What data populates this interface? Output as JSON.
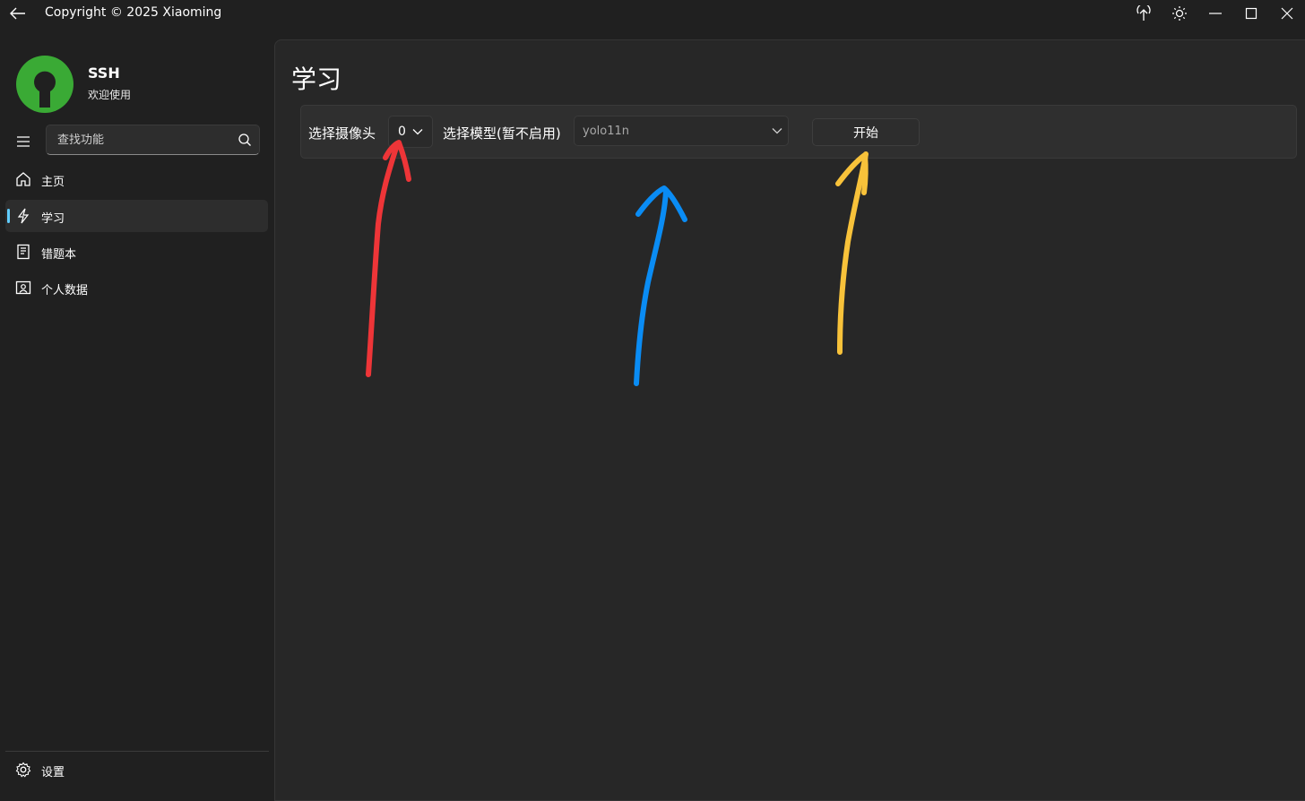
{
  "titlebar": {
    "title": "Copyright © 2025 Xiaoming",
    "back_icon": "back-arrow-icon",
    "actions": [
      "pin-up-icon",
      "theme-sun-icon",
      "minimize-icon",
      "maximize-icon",
      "close-icon"
    ]
  },
  "sidebar": {
    "user": {
      "name": "SSH",
      "subtitle": "欢迎使用"
    },
    "search": {
      "placeholder": "查找功能"
    },
    "items": [
      {
        "label": "主页",
        "icon": "home-icon",
        "active": false
      },
      {
        "label": "学习",
        "icon": "lightning-icon",
        "active": true
      },
      {
        "label": "错题本",
        "icon": "notebook-icon",
        "active": false
      },
      {
        "label": "个人数据",
        "icon": "contact-icon",
        "active": false
      }
    ],
    "settings": {
      "label": "设置",
      "icon": "gear-icon"
    }
  },
  "main": {
    "title": "学习",
    "toolbar": {
      "camera_label": "选择摄像头",
      "camera_value": "0",
      "model_label": "选择模型(暂不启用)",
      "model_value": "yolo11n",
      "start_label": "开始"
    }
  },
  "colors": {
    "accent": "#60cdff",
    "arrow_red": "#ee3538",
    "arrow_blue": "#0a8cf4",
    "arrow_yellow": "#f8c23a",
    "logo_green": "#3aaa35"
  }
}
